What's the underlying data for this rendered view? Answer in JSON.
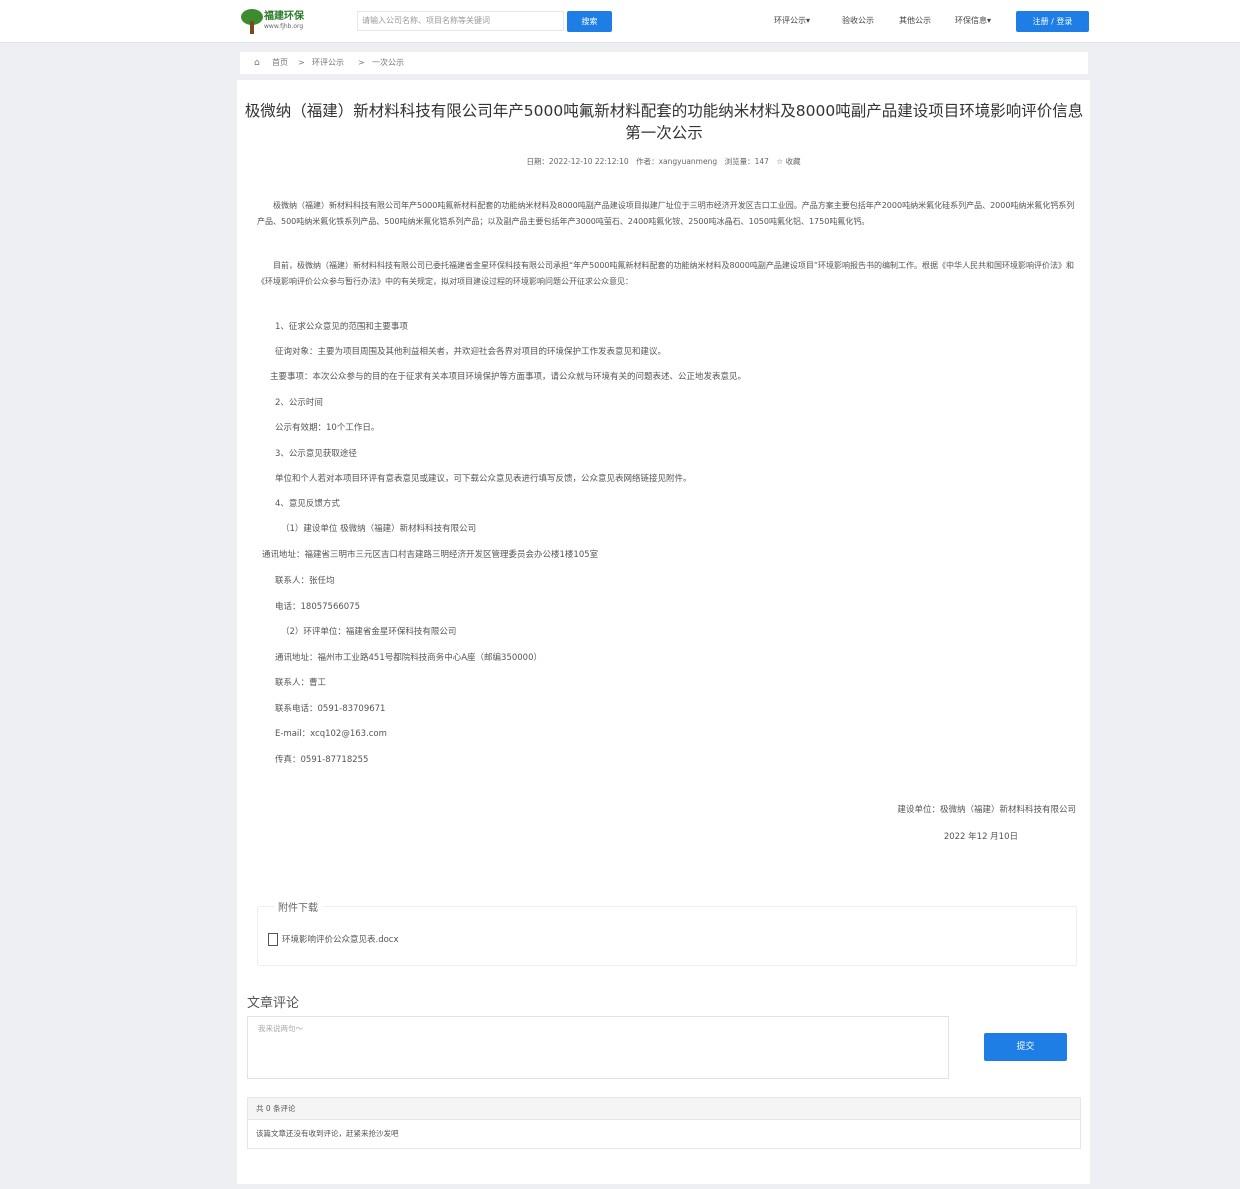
{
  "header": {
    "logo_text": "福建环保",
    "logo_sub": "www.fjhb.org",
    "search_placeholder": "请输入公司名称、项目名称等关键词",
    "search_button": "搜索",
    "nav": [
      "环评公示▾",
      "验收公示",
      "其他公示",
      "环保信息▾"
    ],
    "login_button": "注册 / 登录"
  },
  "breadcrumb": [
    "首页",
    "环评公示",
    "一次公示"
  ],
  "article": {
    "title": "极微纳（福建）新材料科技有限公司年产5000吨氟新材料配套的功能纳米材料及8000吨副产品建设项目环境影响评价信息第一次公示",
    "meta": "日期：2022-12-10 22:12:10　作者：xangyuanmeng　浏览量：147　☆ 收藏",
    "paragraphs": [
      "极微纳（福建）新材料科技有限公司年产5000吨氟新材料配套的功能纳米材料及8000吨副产品建设项目拟建厂址位于三明市经济开发区吉口工业园。产品方案主要包括年产2000吨纳米氟化硅系列产品、2000吨纳米氟化钙系列产品、500吨纳米氟化铁系列产品、500吨纳米氟化锆系列产品；以及副产品主要包括年产3000吨萤石、2400吨氟化铵、2500吨冰晶石、1050吨氟化铝、1750吨氟化钙。",
      "目前，极微纳（福建）新材料科技有限公司已委托福建省金星环保科技有限公司承担“年产5000吨氟新材料配套的功能纳米材料及8000吨副产品建设项目”环境影响报告书的编制工作。根据《中华人民共和国环境影响评价法》和《环境影响评价公众参与暂行办法》中的有关规定，拟对项目建设过程的环境影响问题公开征求公众意见："
    ],
    "lines": [
      "1、征求公众意见的范围和主要事项",
      "征询对象：主要为项目周围及其他利益相关者，并欢迎社会各界对项目的环境保护工作发表意见和建议。",
      "主要事项：本次公众参与的目的在于征求有关本项目环境保护等方面事项，请公众就与环境有关的问题表述、公正地发表意见。",
      "2、公示时间",
      "公示有效期：10个工作日。",
      "3、公示意见获取途径",
      "单位和个人若对本项目环评有意表意见或建议，可下载公众意见表进行填写反馈，公众意见表网络链接见附件。",
      "4、意见反馈方式",
      "（1）建设单位 极微纳（福建）新材料科技有限公司",
      "通讯地址：福建省三明市三元区吉口村吉建路三明经济开发区管理委员会办公楼1楼105室",
      "联系人：张任均",
      "电话：18057566075",
      "（2）环评单位：福建省金星环保科技有限公司",
      "通讯地址：福州市工业路451号都院科技商务中心A座（邮编350000）",
      "联系人：曹工",
      "联系电话：0591-83709671",
      "E-mail：xcq102@163.com",
      "传真：0591-87718255"
    ],
    "signature_unit": "建设单位：极微纳（福建）新材料科技有限公司",
    "signature_date": "2022 年12 月10日"
  },
  "attachments": {
    "title": "附件下载",
    "files": [
      "环境影响评价公众意见表.docx"
    ]
  },
  "comments": {
    "heading": "文章评论",
    "placeholder": "我来说两句～",
    "submit_label": "提交",
    "count_text": "共 0 条评论",
    "empty_text": "该篇文章还没有收到评论，赶紧来抢沙发吧"
  }
}
